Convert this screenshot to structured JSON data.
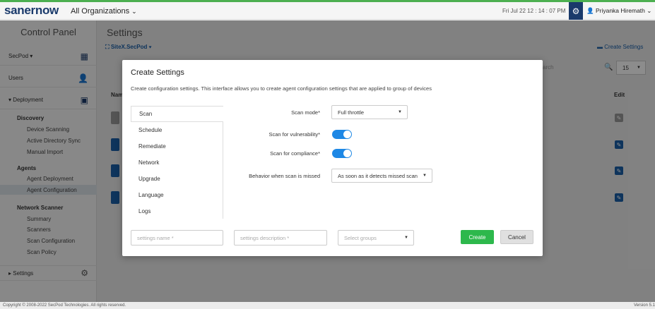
{
  "app": {
    "logo_part1": "saner",
    "logo_part2": "now",
    "org": "All Organizations",
    "datetime": "Fri Jul 22  12 : 14 : 07 PM",
    "user": "Priyanka Hiremath",
    "accent": "#1a3a6b",
    "brand_green": "#4caf50"
  },
  "sidebar": {
    "title": "Control Panel",
    "secpod": "SecPod",
    "users": "Users",
    "deployment": "Deployment",
    "discovery_head": "Discovery",
    "discovery_items": [
      "Device Scanning",
      "Active Directory Sync",
      "Manual Import"
    ],
    "agents_head": "Agents",
    "agents_items": [
      "Agent Deployment",
      "Agent Configuration"
    ],
    "network_head": "Network Scanner",
    "network_items": [
      "Summary",
      "Scanners",
      "Scan Configuration",
      "Scan Policy"
    ],
    "settings": "Settings"
  },
  "main": {
    "title": "Settings",
    "site": "SiteX.SecPod",
    "create_link": "Create Settings",
    "search_placeholder": "arch",
    "page_size": "15",
    "col_name": "Nam",
    "col_edit": "Edit"
  },
  "modal": {
    "title": "Create Settings",
    "description": "Create configuration settings. This interface allows you to create agent configuration settings that are applied to group of devices",
    "tabs": [
      "Scan",
      "Schedule",
      "Remediate",
      "Network",
      "Upgrade",
      "Language",
      "Logs"
    ],
    "scan_mode_label": "Scan mode*",
    "scan_mode_value": "Full throttle",
    "vuln_label": "Scan for vulnerability*",
    "vuln_on": true,
    "compliance_label": "Scan for compliance*",
    "compliance_on": true,
    "missed_label": "Behavior when scan is missed",
    "missed_value": "As soon as it detects missed scan",
    "name_placeholder": "settings name *",
    "desc_placeholder": "settings description *",
    "groups_placeholder": "Select groups",
    "create_label": "Create",
    "cancel_label": "Cancel"
  },
  "footer": {
    "copyright": "Copyright © 2008-2022 SecPod Technologies. All rights reserved.",
    "version": "Version 5.1"
  }
}
